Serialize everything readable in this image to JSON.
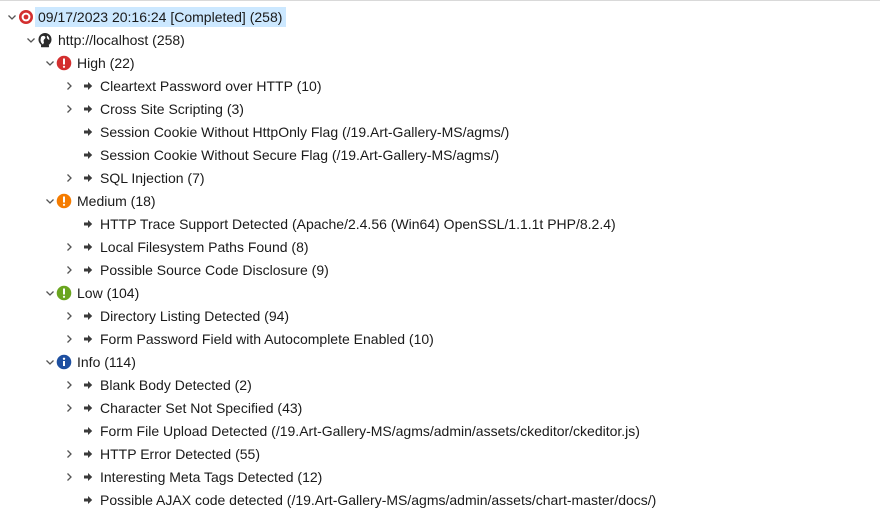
{
  "scan": {
    "label": "09/17/2023 20:16:24 [Completed]  (258)"
  },
  "host": {
    "label": "http://localhost (258)"
  },
  "groups": [
    {
      "label": "High (22)",
      "color": "#d32f2f",
      "items": [
        {
          "label": "Cleartext Password over HTTP (10)",
          "expandable": true
        },
        {
          "label": "Cross Site Scripting (3)",
          "expandable": true
        },
        {
          "label": "Session Cookie Without HttpOnly Flag  (/19.Art-Gallery-MS/agms/)",
          "expandable": false
        },
        {
          "label": "Session Cookie Without Secure Flag  (/19.Art-Gallery-MS/agms/)",
          "expandable": false
        },
        {
          "label": "SQL Injection (7)",
          "expandable": true
        }
      ]
    },
    {
      "label": "Medium (18)",
      "color": "#f57c00",
      "items": [
        {
          "label": "HTTP Trace Support Detected (Apache/2.4.56 (Win64) OpenSSL/1.1.1t PHP/8.2.4)",
          "expandable": false
        },
        {
          "label": "Local Filesystem Paths Found (8)",
          "expandable": true
        },
        {
          "label": "Possible Source Code Disclosure (9)",
          "expandable": true
        }
      ]
    },
    {
      "label": "Low (104)",
      "color": "#6aa51f",
      "items": [
        {
          "label": "Directory Listing Detected (94)",
          "expandable": true
        },
        {
          "label": "Form Password Field with Autocomplete Enabled (10)",
          "expandable": true
        }
      ]
    },
    {
      "label": "Info (114)",
      "color": "#1e4fa0",
      "items": [
        {
          "label": "Blank Body Detected (2)",
          "expandable": true
        },
        {
          "label": "Character Set Not Specified  (43)",
          "expandable": true
        },
        {
          "label": "Form File Upload Detected (/19.Art-Gallery-MS/agms/admin/assets/ckeditor/ckeditor.js)",
          "expandable": false
        },
        {
          "label": "HTTP Error Detected (55)",
          "expandable": true
        },
        {
          "label": "Interesting Meta Tags Detected (12)",
          "expandable": true
        },
        {
          "label": "Possible AJAX code detected (/19.Art-Gallery-MS/agms/admin/assets/chart-master/docs/)",
          "expandable": false
        }
      ]
    }
  ],
  "colors": {
    "selection": "#cce8ff",
    "scan_icon": "#d32f2f"
  },
  "icons": {
    "scan": "target-icon",
    "host": "globe-icon",
    "severity": "exclamation-icon",
    "info": "info-icon",
    "finding": "arrow-right-icon"
  }
}
